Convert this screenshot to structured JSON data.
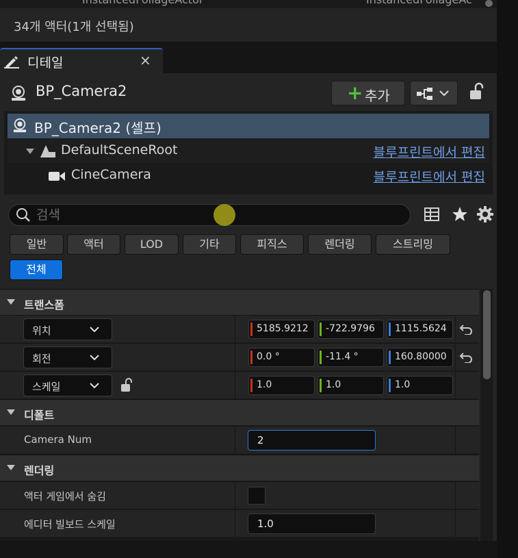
{
  "outliner": {
    "cut_left": "InstancedFoliageActor",
    "cut_right": "InstancedFoliageAc",
    "actor_count": "34개 액터(1개 선택됨)"
  },
  "tab": {
    "label": "디테일",
    "close": "×"
  },
  "header": {
    "actor_name": "BP_Camera2",
    "add_label": "추가"
  },
  "tree": {
    "self_label": "BP_Camera2 (셀프)",
    "rows": [
      {
        "label": "DefaultSceneRoot",
        "link": "블루프린트에서 편집"
      },
      {
        "label": "CineCamera",
        "link": "블루프린트에서 편집"
      }
    ]
  },
  "search": {
    "placeholder": "검색"
  },
  "filters": [
    "일반",
    "액터",
    "LOD",
    "기타",
    "피직스",
    "렌더링",
    "스트리밍",
    "전체"
  ],
  "transform": {
    "category": "트랜스폼",
    "location": {
      "label": "위치",
      "x": "5185.9212",
      "y": "-722.9796",
      "z": "1115.5624"
    },
    "rotation": {
      "label": "회전",
      "x": "0.0 °",
      "y": "-11.4 °",
      "z": "160.80000"
    },
    "scale": {
      "label": "스케일",
      "x": "1.0",
      "y": "1.0",
      "z": "1.0"
    }
  },
  "default": {
    "category": "디폴트",
    "camera_num_label": "Camera Num",
    "camera_num_value": "2"
  },
  "rendering": {
    "category": "렌더링",
    "hidden_in_game_label": "액터 게임에서 숨김",
    "billboard_label": "에디터 빌보드 스케일",
    "billboard_value": "1.0"
  },
  "colors": {
    "accent": "#0f70dd",
    "x_axis": "#c8331e",
    "y_axis": "#6cb41e",
    "z_axis": "#3a7ad8",
    "link": "#6e9fe6"
  }
}
